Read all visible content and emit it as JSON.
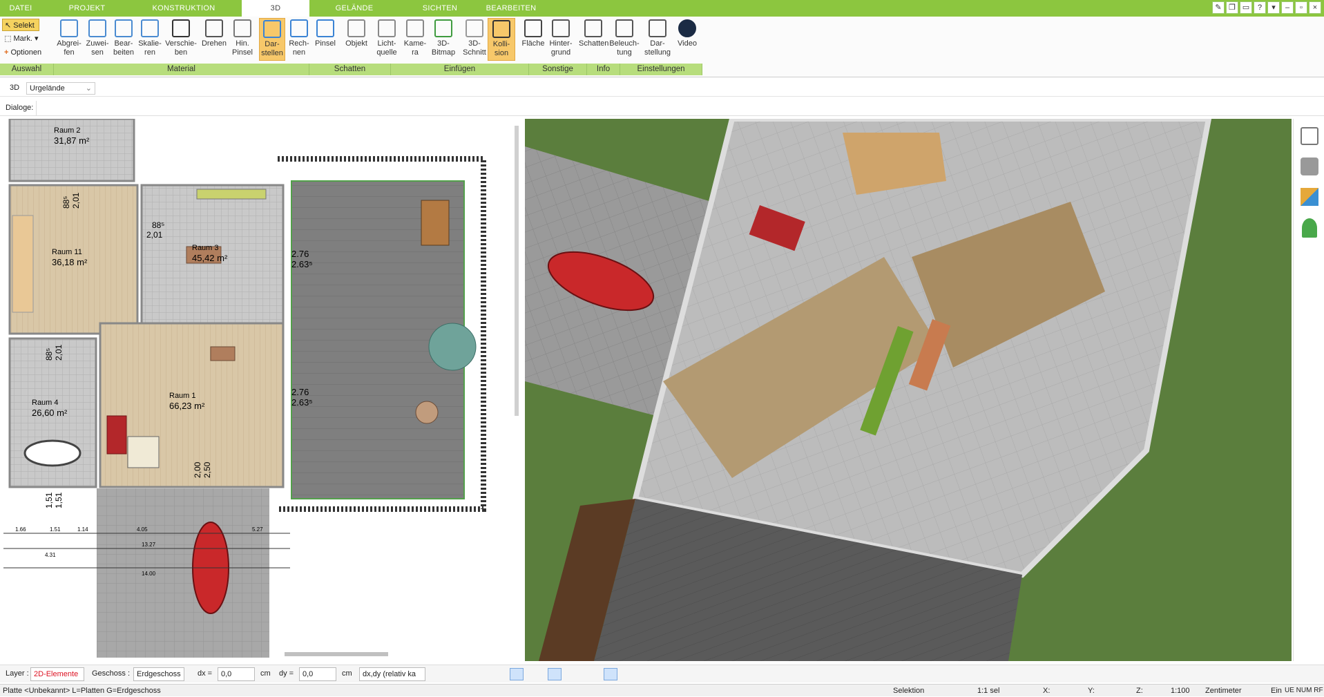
{
  "tabs": [
    {
      "label": "DATEI"
    },
    {
      "label": "PROJEKT"
    },
    {
      "label": "KONSTRUKTION"
    },
    {
      "label": "3D"
    },
    {
      "label": "GELÄNDE"
    },
    {
      "label": "SICHTEN"
    },
    {
      "label": "BEARBEITEN"
    }
  ],
  "side_buttons": {
    "selekt": "Selekt",
    "mark": "Mark.",
    "optionen": "Optionen"
  },
  "ribbon_buttons": [
    {
      "label": "Abgrei-\nfen"
    },
    {
      "label": "Zuwei-\nsen"
    },
    {
      "label": "Bear-\nbeiten"
    },
    {
      "label": "Skalie-\nren"
    },
    {
      "label": "Verschie-\nben"
    },
    {
      "label": "Drehen"
    },
    {
      "label": "Hin.\nPinsel"
    },
    {
      "label": "Dar-\nstellen"
    },
    {
      "label": "Rech-\nnen"
    },
    {
      "label": "Pinsel"
    },
    {
      "label": "Objekt"
    },
    {
      "label": "Licht-\nquelle"
    },
    {
      "label": "Kame-\nra"
    },
    {
      "label": "3D-\nBitmap"
    },
    {
      "label": "3D-\nSchnitt"
    },
    {
      "label": "Kolli-\nsion"
    },
    {
      "label": "Fläche"
    },
    {
      "label": "Hinter-\ngrund"
    },
    {
      "label": "Schatten"
    },
    {
      "label": "Beleuch-\ntung"
    },
    {
      "label": "Dar-\nstellung"
    },
    {
      "label": "Video"
    }
  ],
  "group_labels": [
    "Auswahl",
    "Material",
    "Schatten",
    "Einfügen",
    "Sonstige",
    "Info",
    "Einstellungen"
  ],
  "viewbar": {
    "mode": "3D",
    "selection": "Urgelände"
  },
  "dialogbar": {
    "label": "Dialoge:"
  },
  "plan": {
    "rooms": [
      {
        "name": "Raum 2",
        "area": "31,87 m²"
      },
      {
        "name": "Raum 11",
        "area": "36,18 m²"
      },
      {
        "name": "Raum 3",
        "area": "45,42 m²"
      },
      {
        "name": "Raum 4",
        "area": "26,60 m²"
      },
      {
        "name": "Raum 1",
        "area": "66,23 m²"
      }
    ],
    "dims": [
      "88⁵",
      "2,01",
      "88⁵",
      "2,01",
      "88⁵",
      "2,01",
      "2.76",
      "2.63⁵",
      "2.76",
      "2.63⁵",
      "2,00",
      "2,50",
      "1,51",
      "1,51",
      "1.66",
      "1.51",
      "1.14",
      "4.05",
      "5.27",
      "13.27",
      "4.31",
      "14.00"
    ]
  },
  "inputbar": {
    "layer_label": "Layer :",
    "layer_value": "2D-Elemente",
    "geschoss_label": "Geschoss :",
    "geschoss_value": "Erdgeschoss",
    "dx_label": "dx =",
    "dx_value": "0,0",
    "dx_unit": "cm",
    "dy_label": "dy =",
    "dy_value": "0,0",
    "dy_unit": "cm",
    "mode_value": "dx,dy (relativ ka"
  },
  "statusbar": {
    "hint": "Platte <Unbekannt> L=Platten G=Erdgeschoss",
    "mode": "Selektion",
    "sel": "1:1 sel",
    "x": "X:",
    "y": "Y:",
    "z": "Z:",
    "scale": "1:100",
    "unit": "Zentimeter",
    "ein": "Ein",
    "flags": "UE  NUM  RF"
  },
  "colors": {
    "accent": "#8cc63f",
    "group_bar": "#b7dd7c",
    "active_btn": "#f7c86a",
    "grass": "#5b7e3d",
    "car": "#c9282a"
  }
}
